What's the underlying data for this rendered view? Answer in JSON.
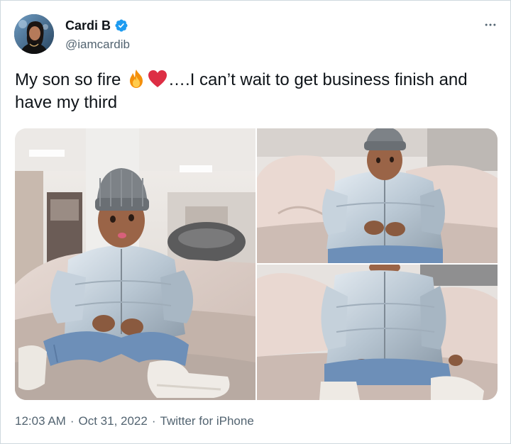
{
  "author": {
    "display_name": "Cardi B",
    "handle": "@iamcardib",
    "verified": true
  },
  "tweet": {
    "text_before_emoji": "My son so fire ",
    "emojis": [
      "fire-emoji",
      "red-heart-emoji"
    ],
    "text_after_emoji": "….I can’t wait to get business finish and have my third"
  },
  "media": {
    "photo_count": 3
  },
  "footer": {
    "time": "12:03 AM",
    "separator": "·",
    "date": "Oct 31, 2022",
    "source": "Twitter for iPhone"
  },
  "colors": {
    "text": "#0f1419",
    "secondary": "#536471",
    "verified_blue": "#1d9bf0",
    "border": "#cfd9de"
  }
}
